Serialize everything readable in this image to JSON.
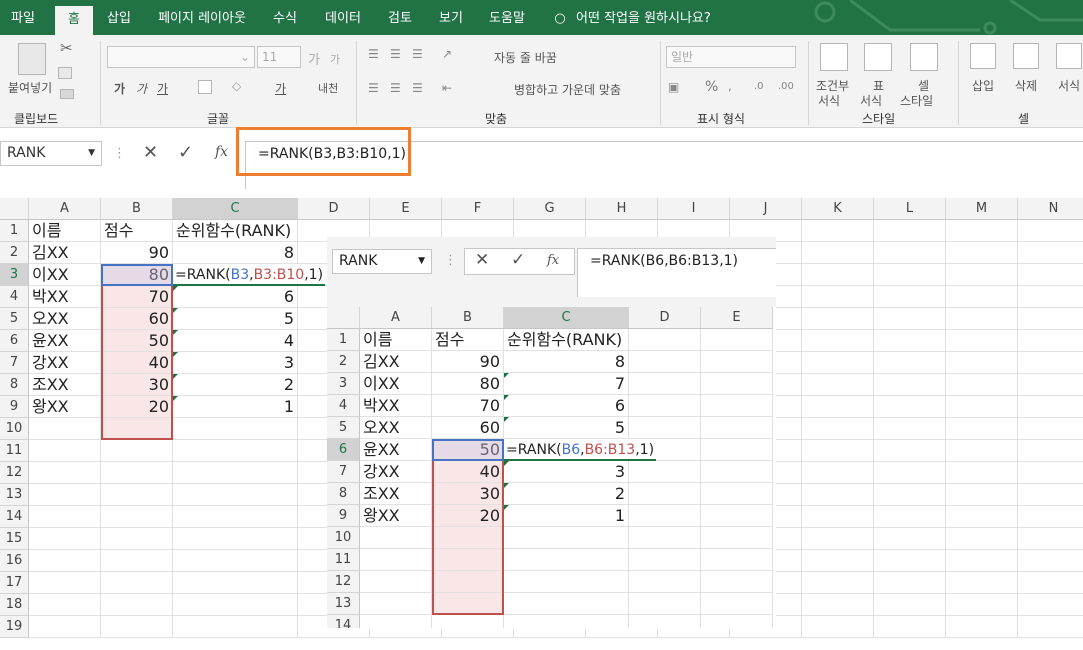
{
  "tabs": [
    "파일",
    "홈",
    "삽입",
    "페이지 레이아웃",
    "수식",
    "데이터",
    "검토",
    "보기",
    "도움말"
  ],
  "tell_me": "어떤 작업을 원하시나요?",
  "ribbon": {
    "clipboard": {
      "label": "클립보드",
      "paste": "붙여넣기"
    },
    "font": {
      "label": "글꼴",
      "size": "11",
      "bold": "가",
      "italic": "가",
      "underline": "가",
      "grow": "가",
      "shrink": "가",
      "fontcolor": "가",
      "phonetic": "내천"
    },
    "align": {
      "label": "맞춤",
      "wrap": "자동 줄 바꿈",
      "merge": "병합하고 가운데 맞춤"
    },
    "number": {
      "label": "표시 형식",
      "format": "일반",
      "percent": "%"
    },
    "styles": {
      "label": "스타일",
      "cond": "조건부",
      "cond2": "서식",
      "table": "표",
      "table2": "서식",
      "cell": "셀",
      "cell2": "스타일"
    },
    "cells": {
      "label": "셀",
      "insert": "삽입",
      "delete": "삭제",
      "format": "서식"
    }
  },
  "namebox": "RANK",
  "formula": "=RANK(B3,B3:B10,1)",
  "fx": "fx",
  "main_cols": [
    "A",
    "B",
    "C",
    "D",
    "E",
    "F",
    "G",
    "H",
    "I",
    "J",
    "K",
    "L",
    "M",
    "N"
  ],
  "main_rows": [
    "1",
    "2",
    "3",
    "4",
    "5",
    "6",
    "7",
    "8",
    "9",
    "10",
    "11",
    "12",
    "13",
    "14",
    "15",
    "16",
    "17",
    "18",
    "19"
  ],
  "main_table": {
    "headers": [
      "이름",
      "점수",
      "순위함수(RANK)"
    ],
    "rows": [
      [
        "김XX",
        "90",
        "8"
      ],
      [
        "이XX",
        "80",
        ""
      ],
      [
        "박XX",
        "70",
        "6"
      ],
      [
        "오XX",
        "60",
        "5"
      ],
      [
        "윤XX",
        "50",
        "4"
      ],
      [
        "강XX",
        "40",
        "3"
      ],
      [
        "조XX",
        "30",
        "2"
      ],
      [
        "왕XX",
        "20",
        "1"
      ]
    ],
    "edit": {
      "a": "=RANK(",
      "b": "B3",
      ",": ",",
      "c": "B3:B10",
      "d": ",1)"
    }
  },
  "inset": {
    "namebox": "RANK",
    "formula": "=RANK(B6,B6:B13,1)",
    "fx": "fx",
    "cols": [
      "A",
      "B",
      "C",
      "D",
      "E"
    ],
    "rows": [
      "1",
      "2",
      "3",
      "4",
      "5",
      "6",
      "7",
      "8",
      "9",
      "10",
      "11",
      "12",
      "13",
      "14"
    ],
    "headers": [
      "이름",
      "점수",
      "순위함수(RANK)"
    ],
    "data": [
      [
        "김XX",
        "90",
        "8"
      ],
      [
        "이XX",
        "80",
        "7"
      ],
      [
        "박XX",
        "70",
        "6"
      ],
      [
        "오XX",
        "60",
        "5"
      ],
      [
        "윤XX",
        "50",
        ""
      ],
      [
        "강XX",
        "40",
        "3"
      ],
      [
        "조XX",
        "30",
        "2"
      ],
      [
        "왕XX",
        "20",
        "1"
      ]
    ],
    "edit": {
      "a": "=RANK(",
      "b": "B6",
      "comma": ",",
      "c": "B6:B13",
      "d": ",1)"
    }
  }
}
